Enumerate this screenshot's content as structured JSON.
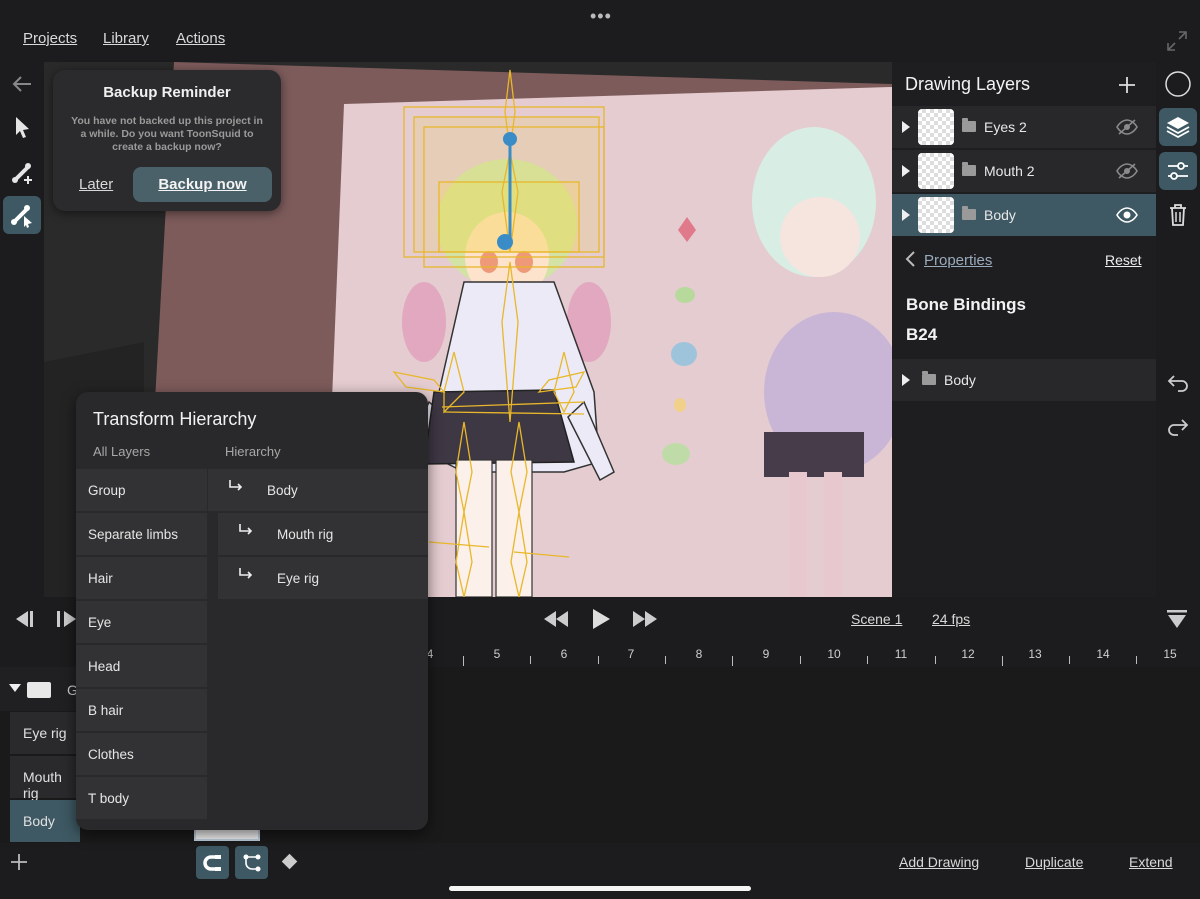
{
  "menu": {
    "projects": "Projects",
    "library": "Library",
    "actions": "Actions"
  },
  "backup": {
    "title": "Backup Reminder",
    "message": "You have not backed up this project in a while. Do you want ToonSquid to create a backup now?",
    "later": "Later",
    "backup_now": "Backup now"
  },
  "layers_panel": {
    "title": "Drawing Layers",
    "layers": [
      {
        "name": "Eyes 2",
        "visible": false
      },
      {
        "name": "Mouth 2",
        "visible": false
      },
      {
        "name": "Body",
        "visible": true,
        "selected": true
      }
    ],
    "properties": {
      "back_label": "Properties",
      "reset": "Reset",
      "section_title": "Bone Bindings",
      "bone_name": "B24",
      "binding_layer": "Body"
    }
  },
  "transport": {
    "scene": "Scene 1",
    "fps": "24 fps"
  },
  "ruler": {
    "ticks": [
      "4",
      "5",
      "6",
      "7",
      "8",
      "9",
      "10",
      "11",
      "12",
      "13",
      "14",
      "15"
    ]
  },
  "timeline": {
    "group_label": "G",
    "tracks": [
      "Eye rig",
      "Mouth rig",
      "Body"
    ]
  },
  "hierarchy": {
    "title": "Transform Hierarchy",
    "col_all": "All Layers",
    "col_hier": "Hierarchy",
    "all_layers": [
      "Group",
      "Separate limbs",
      "Hair",
      "Eye",
      "Head",
      "B hair",
      "Clothes",
      "T body"
    ],
    "tree": [
      {
        "label": "Body",
        "level": 0
      },
      {
        "label": "Mouth rig",
        "level": 1
      },
      {
        "label": "Eye rig",
        "level": 1
      }
    ]
  },
  "bottom": {
    "add_drawing": "Add Drawing",
    "duplicate": "Duplicate",
    "extend": "Extend"
  },
  "colors": {
    "accent": "#3e5963",
    "panel": "#28282a",
    "canvas_wall": "#7d5b5b",
    "bone": "#e8b72a"
  }
}
